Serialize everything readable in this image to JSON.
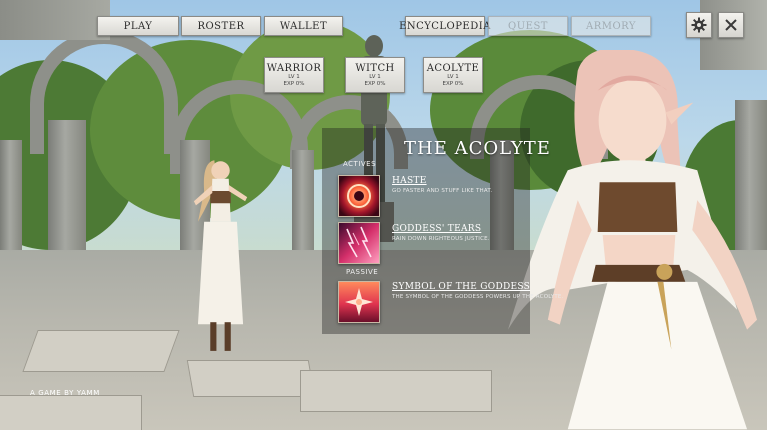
{
  "nav": {
    "play": "Play",
    "roster": "Roster",
    "wallet": "Wallet",
    "encyclopedia": "Encyclopedia",
    "quest": "Quest",
    "armory": "Armory"
  },
  "icons": {
    "settings": "gear-icon",
    "close": "close-icon"
  },
  "classes": [
    {
      "name": "Warrior",
      "level": "LV 1",
      "exp": "EXP 0%"
    },
    {
      "name": "Witch",
      "level": "LV 1",
      "exp": "EXP 0%"
    },
    {
      "name": "Acolyte",
      "level": "LV 1",
      "exp": "EXP 0%"
    }
  ],
  "panel": {
    "title": "The Acolyte",
    "actives_label": "Actives",
    "passive_label": "Passive",
    "skills": [
      {
        "name": "Haste",
        "desc": "Go faster and stuff like that."
      },
      {
        "name": "Goddess' Tears",
        "desc": "Rain down righteous justice."
      },
      {
        "name": "Symbol of the Goddess",
        "desc": "The symbol of the goddess powers up the acolyte."
      }
    ]
  },
  "footer": {
    "credit": "A Game by YAMM"
  },
  "colors": {
    "panel_bg": "#1e1e1e",
    "button_face": "#eceae5",
    "text_light": "#ffffff"
  }
}
